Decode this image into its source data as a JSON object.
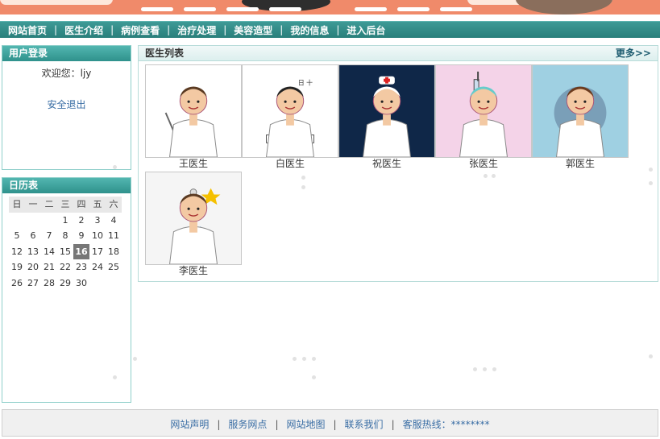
{
  "nav": {
    "items": [
      "网站首页",
      "医生介绍",
      "病例查看",
      "治疗处理",
      "美容造型",
      "我的信息",
      "进入后台"
    ]
  },
  "login": {
    "title": "用户登录",
    "welcome": "欢迎您：ljy",
    "logout": "安全退出"
  },
  "calendar": {
    "title": "日历表",
    "weekdays": [
      "日",
      "一",
      "二",
      "三",
      "四",
      "五",
      "六"
    ],
    "leading_blanks": 3,
    "days": [
      "1",
      "2",
      "3",
      "4",
      "5",
      "6",
      "7",
      "8",
      "9",
      "10",
      "11",
      "12",
      "13",
      "14",
      "15",
      "16",
      "17",
      "18",
      "19",
      "20",
      "21",
      "22",
      "23",
      "24",
      "25",
      "26",
      "27",
      "28",
      "29",
      "30"
    ],
    "today": "16"
  },
  "doctors": {
    "title": "医生列表",
    "more": "更多>>",
    "list": [
      {
        "name": "王医生",
        "pic": "doctor-glasses-icon",
        "bg": "#ffffff"
      },
      {
        "name": "白医生",
        "pic": "doctor-sketch-icon",
        "bg": "#ffffff"
      },
      {
        "name": "祝医生",
        "pic": "doctor-cartoon-icon",
        "bg": "#0f2748"
      },
      {
        "name": "张医生",
        "pic": "doctor-syringe-icon",
        "bg": "#f4d3e8"
      },
      {
        "name": "郭医生",
        "pic": "doctor-female-icon",
        "bg": "#9fd0e2"
      },
      {
        "name": "李医生",
        "pic": "doctor-thumbsup-icon",
        "bg": "#f5f5f5"
      }
    ]
  },
  "footer": {
    "links": [
      "网站声明",
      "服务网点",
      "网站地图",
      "联系我们"
    ],
    "hotline": "客服热线：********"
  }
}
